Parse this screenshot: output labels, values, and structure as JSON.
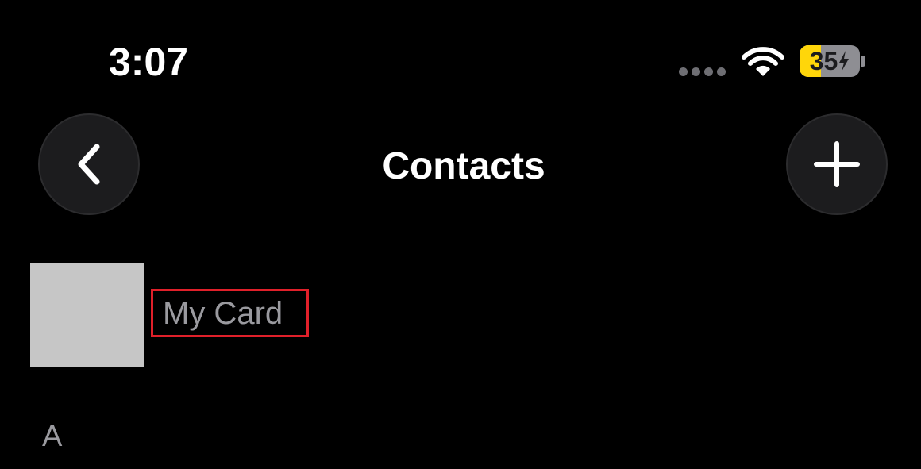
{
  "status_bar": {
    "time": "3:07",
    "battery_level": "35",
    "battery_percent": 35,
    "charging": true,
    "icons": [
      "signal-dots-icon",
      "wifi-icon",
      "battery-icon",
      "bolt-icon"
    ]
  },
  "nav": {
    "title": "Contacts",
    "back_icon": "chevron-left-icon",
    "add_icon": "plus-icon"
  },
  "my_card": {
    "label": "My Card"
  },
  "sections": [
    {
      "letter": "A"
    }
  ],
  "colors": {
    "background": "#000000",
    "button_bg": "#1c1c1e",
    "battery_yellow": "#ffd60a",
    "battery_gray": "#8e8e93",
    "highlight_red": "#e0202a",
    "secondary_text": "#9a9a9f"
  }
}
